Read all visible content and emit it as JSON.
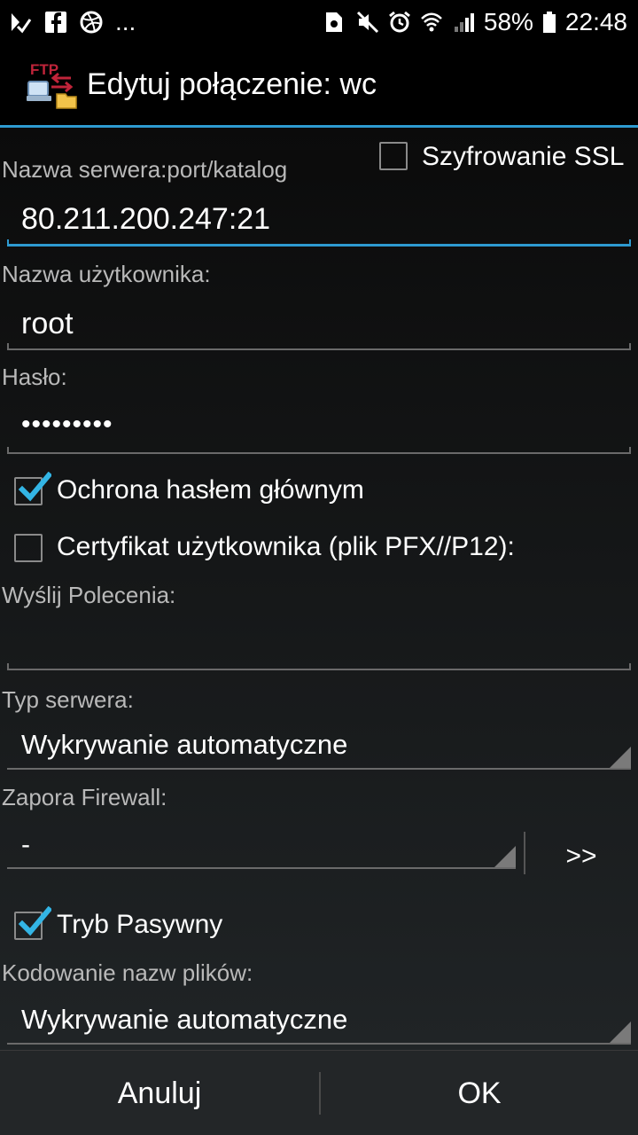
{
  "status_bar": {
    "left_icons": [
      "play-check-icon",
      "facebook-icon",
      "dribbble-icon"
    ],
    "more": "...",
    "right_icons": [
      "sim-icon",
      "mute-icon",
      "alarm-icon",
      "wifi-icon",
      "signal-icon",
      "battery-icon"
    ],
    "battery": "58%",
    "time": "22:48"
  },
  "header": {
    "app_icon": "ftp-app-icon",
    "app_icon_text": "FTP",
    "title": "Edytuj połączenie: wc",
    "accent": "#2e9ad0"
  },
  "form": {
    "server_label": "Nazwa serwera:port/katalog",
    "ssl_label": "Szyfrowanie SSL",
    "ssl_checked": false,
    "server_value": "80.211.200.247:21",
    "username_label": "Nazwa użytkownika:",
    "username_value": "root",
    "password_label": "Hasło:",
    "password_value": "•••••••••",
    "master_password_label": "Ochrona hasłem głównym",
    "master_password_checked": true,
    "certificate_label": "Certyfikat użytkownika (plik PFX//P12):",
    "certificate_checked": false,
    "commands_label": "Wyślij Polecenia:",
    "commands_value": "",
    "server_type_label": "Typ serwera:",
    "server_type_value": "Wykrywanie automatyczne",
    "firewall_label": "Zapora Firewall:",
    "firewall_value": "-",
    "firewall_button": ">>",
    "passive_label": "Tryb Pasywny",
    "passive_checked": true,
    "encoding_label": "Kodowanie nazw plików:",
    "encoding_value": "Wykrywanie automatyczne",
    "check_color": "#33b5e5"
  },
  "buttons": {
    "cancel": "Anuluj",
    "ok": "OK"
  }
}
